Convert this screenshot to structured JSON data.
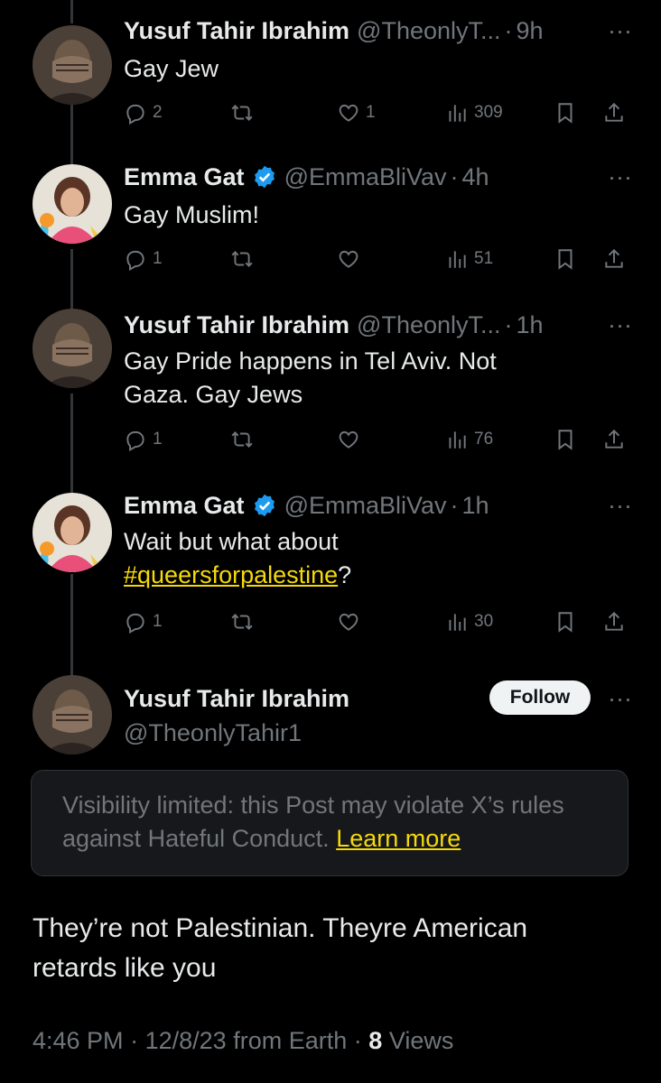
{
  "tweets": [
    {
      "name": "Yusuf Tahir Ibrahim",
      "handle": "@TheonlyT...",
      "time": "9h",
      "text": "Gay Jew",
      "replies": "2",
      "retweets": "",
      "likes": "1",
      "views": "309"
    },
    {
      "name": "Emma Gat",
      "handle": "@EmmaBliVav",
      "time": "4h",
      "text": "Gay Muslim!",
      "replies": "1",
      "retweets": "",
      "likes": "",
      "views": "51"
    },
    {
      "name": "Yusuf Tahir Ibrahim",
      "handle": "@TheonlyT...",
      "time": "1h",
      "text_line1": "Gay Pride happens in Tel Aviv. Not",
      "text_line2": "Gaza. Gay Jews",
      "replies": "1",
      "retweets": "",
      "likes": "",
      "views": "76"
    },
    {
      "name": "Emma Gat",
      "handle": "@EmmaBliVav",
      "time": "1h",
      "text_line1": "Wait but what about",
      "hashtag": "#queersforpalestine",
      "text_after": "?",
      "replies": "1",
      "retweets": "",
      "likes": "",
      "views": "30"
    }
  ],
  "main": {
    "name": "Yusuf Tahir Ibrahim",
    "handle": "@TheonlyTahir1",
    "follow_label": "Follow",
    "notice_text": "Visibility limited: this Post may violate X’s rules against Hateful Conduct.",
    "learn_more": "Learn more",
    "text_line1": "They’re not Palestinian. Theyre American",
    "text_line2": "retards like you",
    "time": "4:46 PM",
    "date": "12/8/23",
    "source": "from Earth",
    "views_count": "8",
    "views_label": "Views"
  },
  "separator_dot": "·",
  "more_glyph": "···",
  "icons": [
    "reply-icon",
    "retweet-icon",
    "like-icon",
    "views-icon",
    "bookmark-icon",
    "share-icon",
    "verified-badge-icon",
    "more-icon"
  ],
  "colors": {
    "background": "#000000",
    "text": "#e7e9ea",
    "muted": "#71767b",
    "accent": "#f5d90a",
    "verified": "#1d9bf0"
  }
}
